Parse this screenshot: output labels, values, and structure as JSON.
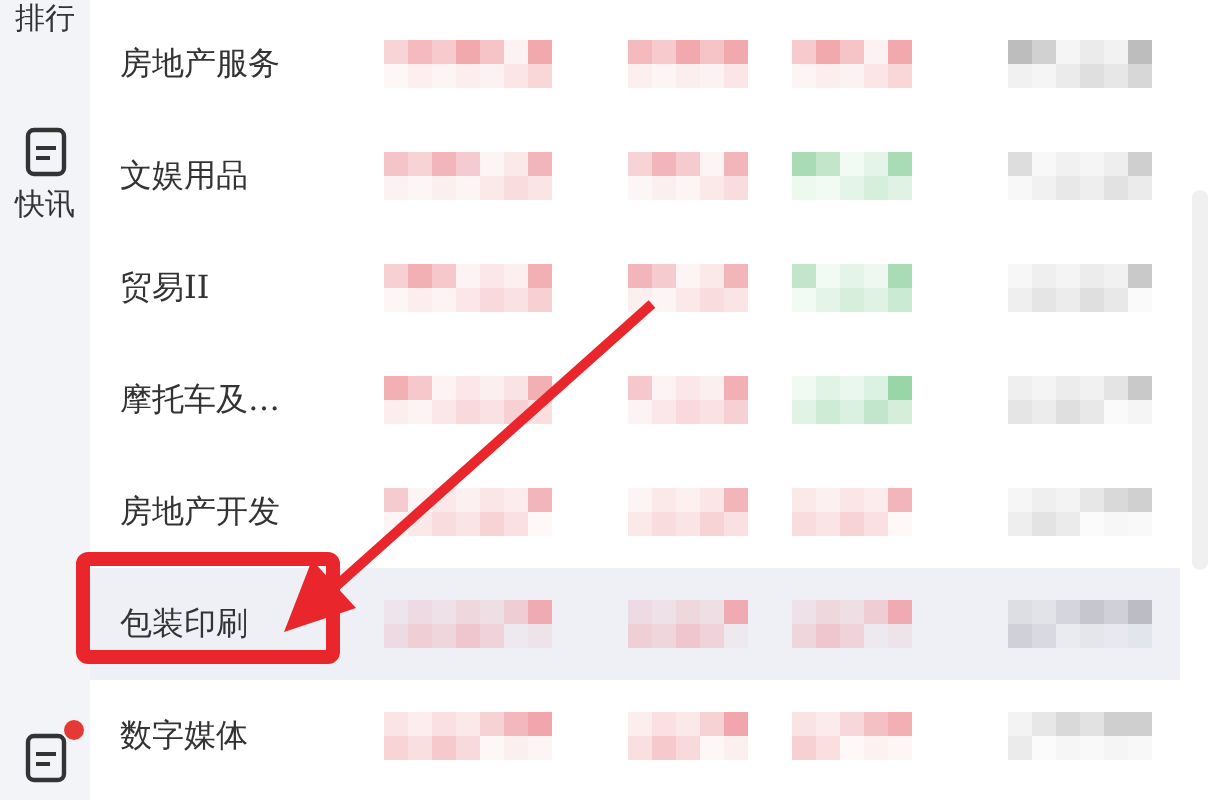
{
  "sidebar": {
    "items": [
      {
        "kind": "text",
        "label": "排行"
      },
      {
        "kind": "icon",
        "label": "快讯"
      },
      {
        "kind": "icon-dot"
      }
    ]
  },
  "rows": [
    {
      "name": "房地产服务",
      "selected": false,
      "cells": [
        {
          "color": "#f2a9ae"
        },
        {
          "color": "#f2a9ae"
        },
        {
          "color": "#f2a9ae"
        },
        {
          "color": "#bdbdbd"
        }
      ]
    },
    {
      "name": "文娱用品",
      "selected": false,
      "cells": [
        {
          "color": "#f2b5ba"
        },
        {
          "color": "#f2b5ba"
        },
        {
          "color": "#a9dcb5"
        },
        {
          "color": "#cfcfcf"
        }
      ]
    },
    {
      "name": "贸易II",
      "selected": false,
      "cells": [
        {
          "color": "#f2b0b5"
        },
        {
          "color": "#f2b5ba"
        },
        {
          "color": "#a9dcb5"
        },
        {
          "color": "#c9c9c9"
        }
      ]
    },
    {
      "name": "摩托车及…",
      "selected": false,
      "cells": [
        {
          "color": "#f2b0b5"
        },
        {
          "color": "#f2b0b5"
        },
        {
          "color": "#98d6a8"
        },
        {
          "color": "#c9c9c9"
        }
      ]
    },
    {
      "name": "房地产开发",
      "selected": false,
      "cells": [
        {
          "color": "#f2b5ba"
        },
        {
          "color": "#f2b5ba"
        },
        {
          "color": "#f2b5ba"
        },
        {
          "color": "#d0d0d0"
        }
      ]
    },
    {
      "name": "包装印刷",
      "selected": true,
      "cells": [
        {
          "color": "#f0aab2"
        },
        {
          "color": "#f0aab2"
        },
        {
          "color": "#f0aab2"
        },
        {
          "color": "#bcbcc4"
        }
      ]
    },
    {
      "name": "数字媒体",
      "selected": false,
      "cells": [
        {
          "color": "#f0a6ac"
        },
        {
          "color": "#f0a6ac"
        },
        {
          "color": "#f2b0b5"
        },
        {
          "color": "#cfcfcf"
        }
      ]
    }
  ]
}
